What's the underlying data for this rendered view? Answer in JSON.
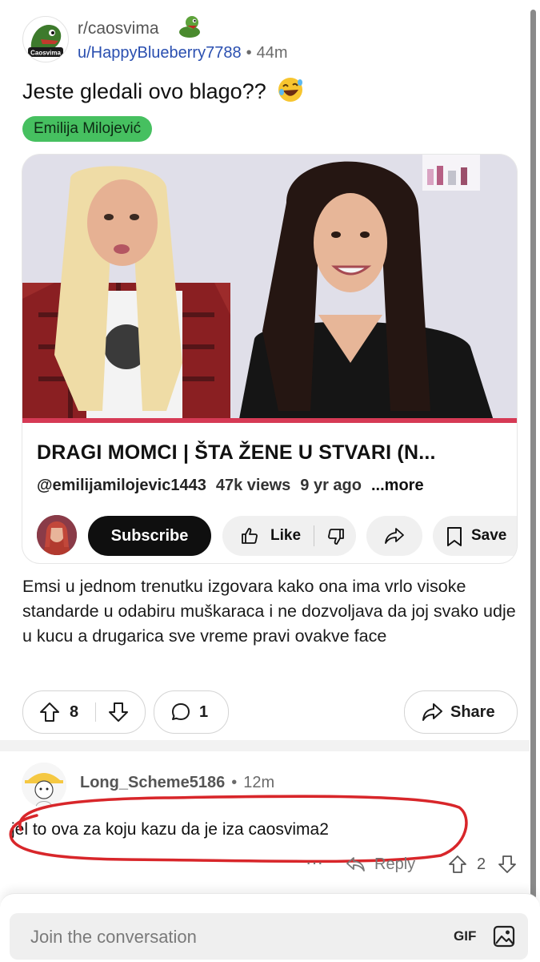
{
  "post": {
    "subreddit": "r/caosvima",
    "avatar_text": "Caosvima",
    "author": "u/HappyBlueberry7788",
    "separator": "•",
    "age": "44m",
    "title": "Jeste gledali ovo blago??",
    "flair": "Emilija Milojević",
    "body": "Emsi u jednom trenutku izgovara kako ona ima vrlo visoke standarde u odabiru muškaraca i ne dozvoljava da joj svako udje u kucu a drugarica sve vreme pravi ovakve face",
    "votes": "8",
    "comments": "1",
    "share_label": "Share"
  },
  "video": {
    "title": "DRAGI MOMCI | ŠTA ŽENE U STVARI (N...",
    "channel": "@emilijamilojevic1443",
    "views": "47k views",
    "age": "9 yr ago",
    "more": "...more",
    "subscribe": "Subscribe",
    "like": "Like",
    "save": "Save"
  },
  "comment": {
    "author": "Long_Scheme5186",
    "separator": "•",
    "age": "12m",
    "text": "jel to ova za koju kazu da je iza caosvima2",
    "reply": "Reply",
    "votes": "2"
  },
  "composer": {
    "placeholder": "Join the conversation",
    "gif": "GIF"
  },
  "colors": {
    "flair_bg": "#46c060",
    "username_link": "#2a4fb0",
    "markup_circle": "#d8262a",
    "video_progress": "#d63a55"
  }
}
